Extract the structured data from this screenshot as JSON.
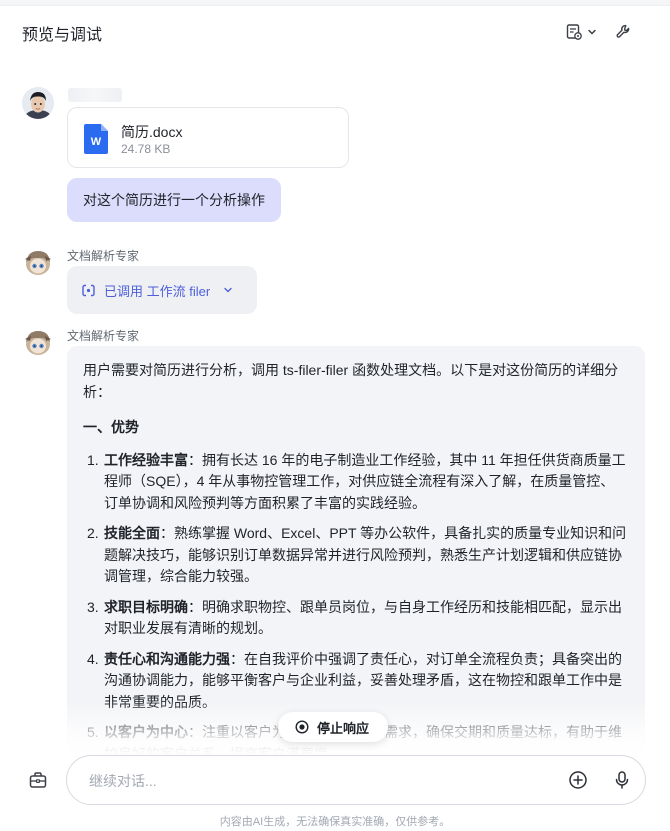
{
  "header": {
    "title": "预览与调试",
    "doc_menu_icon": "document-settings-icon",
    "tools_icon": "wrench-icon"
  },
  "user_message": {
    "file": {
      "icon": "word-doc-icon",
      "name": "简历.docx",
      "size": "24.78 KB"
    },
    "text": "对这个简历进行一个分析操作"
  },
  "bot_messages": [
    {
      "sender": "文档解析专家",
      "workflow_chip": "已调用 工作流 filer"
    },
    {
      "sender": "文档解析专家",
      "intro": "用户需要对简历进行分析，调用 ts-filer-filer 函数处理文档。以下是对这份简历的详细分析：",
      "section_title": "一、优势",
      "items": [
        {
          "num": "1.",
          "title": "工作经验丰富",
          "text": "：拥有长达 16 年的电子制造业工作经验，其中 11 年担任供货商质量工程师（SQE），4 年从事物控管理工作，对供应链全流程有深入了解，在质量管控、订单协调和风险预判等方面积累了丰富的实践经验。"
        },
        {
          "num": "2.",
          "title": "技能全面",
          "text": "：熟练掌握 Word、Excel、PPT 等办公软件，具备扎实的质量专业知识和问题解决技巧，能够识别订单数据异常并进行风险预判，熟悉生产计划逻辑和供应链协调管理，综合能力较强。"
        },
        {
          "num": "3.",
          "title": "求职目标明确",
          "text": "：明确求职物控、跟单员岗位，与自身工作经历和技能相匹配，显示出对职业发展有清晰的规划。"
        },
        {
          "num": "4.",
          "title": "责任心和沟通能力强",
          "text": "：在自我评价中强调了责任心，对订单全流程负责；具备突出的沟通协调能力，能够平衡客户与企业利益，妥善处理矛盾，这在物控和跟单工作中是非常重要的品质。"
        },
        {
          "num": "5.",
          "title": "以客户为中心",
          "text": "：注重以客户为中心，满足客户需求，确保交期和质量达标，有助于维护良好的客户关系，提高客户满意度。"
        }
      ]
    }
  ],
  "stop_button": {
    "icon": "stop-icon",
    "label": "停止响应"
  },
  "composer": {
    "tools_icon": "toolbox-icon",
    "placeholder": "继续对话...",
    "plus_icon": "plus-circle-icon",
    "mic_icon": "microphone-icon"
  },
  "disclaimer": "内容由AI生成，无法确保真实准确，仅供参考。",
  "colors": {
    "accent": "#4e5fd8",
    "user_bubble": "#dcdcfc",
    "answer_bg": "#f3f4f7",
    "word_blue": "#2b6bf0"
  }
}
